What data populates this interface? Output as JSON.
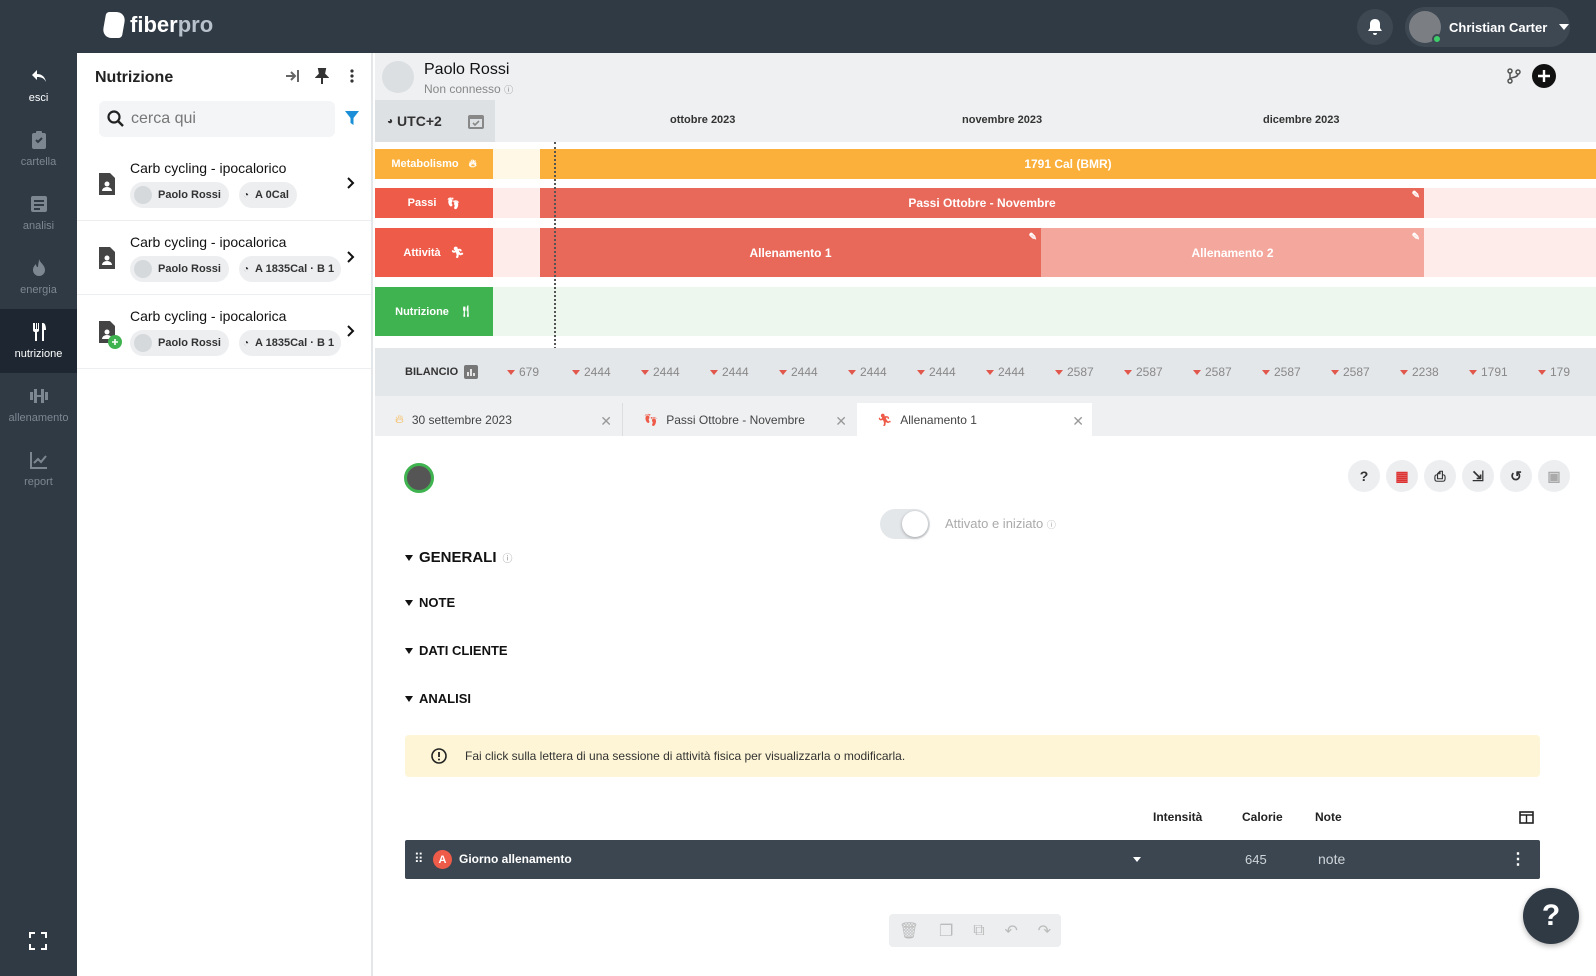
{
  "app": {
    "logo_main": "fiber",
    "logo_accent": "pro",
    "user_name": "Christian Carter"
  },
  "nav": [
    {
      "label": "esci",
      "icon": "undo-arrow-icon"
    },
    {
      "label": "cartella",
      "icon": "clipboard-icon"
    },
    {
      "label": "analisi",
      "icon": "document-icon"
    },
    {
      "label": "energia",
      "icon": "flame-icon"
    },
    {
      "label": "nutrizione",
      "icon": "fork-knife-icon"
    },
    {
      "label": "allenamento",
      "icon": "dumbbell-icon"
    },
    {
      "label": "report",
      "icon": "chart-line-icon"
    }
  ],
  "panel": {
    "title": "Nutrizione",
    "search_placeholder": "cerca qui",
    "items": [
      {
        "title": "Carb cycling - ipocalorico",
        "person": "Paolo Rossi",
        "detail": "A 0Cal"
      },
      {
        "title": "Carb cycling - ipocalorica",
        "person": "Paolo Rossi",
        "detail": "A 1835Cal · B 1"
      },
      {
        "title": "Carb cycling - ipocalorica",
        "person": "Paolo Rossi",
        "detail": "A 1835Cal · B 1"
      }
    ]
  },
  "patient": {
    "name": "Paolo Rossi",
    "status": "Non connesso"
  },
  "timeline": {
    "timezone": "UTC+2",
    "months": [
      "ottobre 2023",
      "novembre 2023",
      "dicembre 2023"
    ],
    "lanes": {
      "metabolismo": {
        "label": "Metabolismo",
        "bar": "1791 Cal (BMR)",
        "color": "#fbb03b"
      },
      "passi": {
        "label": "Passi",
        "bar": "Passi Ottobre - Novembre",
        "color": "#ef5b49"
      },
      "attivita": {
        "label": "Attività",
        "bar1": "Allenamento 1",
        "bar2": "Allenamento 2",
        "color": "#ef5b49"
      },
      "nutrizione": {
        "label": "Nutrizione",
        "color": "#3fb34f"
      }
    },
    "bilancio_label": "BILANCIO",
    "bilancio_values": [
      "679",
      "2444",
      "2444",
      "2444",
      "2444",
      "2444",
      "2444",
      "2444",
      "2587",
      "2587",
      "2587",
      "2587",
      "2587",
      "2238",
      "1791",
      "179"
    ]
  },
  "tabs": [
    {
      "label": "30 settembre 2023",
      "icon": "flame-icon"
    },
    {
      "label": "Passi Ottobre - Novembre",
      "icon": "footsteps-icon"
    },
    {
      "label": "Allenamento 1",
      "icon": "runner-icon"
    }
  ],
  "detail": {
    "toggle_label": "Attivato e iniziato",
    "sections": [
      "GENERALI",
      "NOTE",
      "DATI CLIENTE",
      "ANALISI"
    ],
    "alert": "Fai click sulla lettera di una sessione di attività fisica per visualizzarla o modificarla.",
    "columns": [
      "Intensità",
      "Calorie",
      "Note"
    ],
    "row": {
      "letter": "A",
      "name": "Giorno allenamento",
      "calories": "645",
      "note": "note"
    }
  }
}
